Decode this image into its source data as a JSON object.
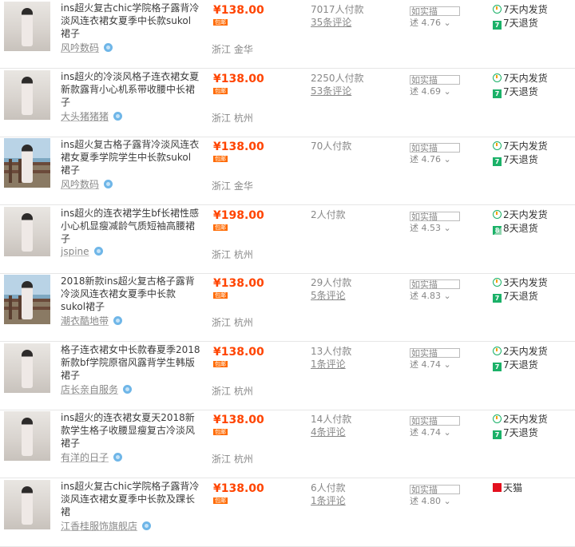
{
  "products": [
    {
      "title": "ins超火复古chic学院格子露背冷淡风连衣裙女夏季中长款sukol裙子",
      "price": "¥138.00",
      "shipping_tag": "包邮",
      "shop": "风吟数码",
      "location": "浙江 金华",
      "sales": "7017人付款",
      "reviews": "35条评论",
      "desc_label": "如实描",
      "score": "述 4.76 ⌄",
      "services": [
        {
          "icon": "clock-icon",
          "label": "7天内发货"
        },
        {
          "icon": "seven-day-return-icon",
          "label": "7天退货"
        }
      ],
      "image": "girl-indoor"
    },
    {
      "title": "ins超火的冷淡风格子连衣裙女夏新款露背小心机系带收腰中长裙子",
      "price": "¥138.00",
      "shipping_tag": "包邮",
      "shop": "大头猪猪猪",
      "location": "浙江 杭州",
      "sales": "2250人付款",
      "reviews": "53条评论",
      "desc_label": "如实描",
      "score": "述 4.69 ⌄",
      "services": [
        {
          "icon": "clock-icon",
          "label": "7天内发货"
        },
        {
          "icon": "seven-day-return-icon",
          "label": "7天退货"
        }
      ],
      "image": "girl-indoor"
    },
    {
      "title": "ins超火复古格子露背冷淡风连衣裙女夏季学院学生中长款sukol裙子",
      "price": "¥138.00",
      "shipping_tag": "包邮",
      "shop": "风吟数码",
      "location": "浙江 金华",
      "sales": "70人付款",
      "reviews": "",
      "desc_label": "如实描",
      "score": "述 4.76 ⌄",
      "services": [
        {
          "icon": "clock-icon",
          "label": "7天内发货"
        },
        {
          "icon": "seven-day-return-icon",
          "label": "7天退货"
        }
      ],
      "image": "girl-seaside"
    },
    {
      "title": "ins超火的连衣裙学生bf长裙性感小心机显瘦减龄气质短袖高腰裙子",
      "price": "¥198.00",
      "shipping_tag": "包邮",
      "shop": "jspine",
      "location": "浙江 杭州",
      "sales": "2人付款",
      "reviews": "",
      "desc_label": "如实描",
      "score": "述 4.53 ⌄",
      "services": [
        {
          "icon": "clock-icon",
          "label": "2天内发货"
        },
        {
          "icon": "eight-day-return-icon",
          "label": "8天退货"
        }
      ],
      "image": "girl-indoor"
    },
    {
      "title": "2018新款ins超火复古格子露背冷淡风连衣裙女夏季中长款sukol裙子",
      "price": "¥138.00",
      "shipping_tag": "包邮",
      "shop": "潮衣酷地带",
      "location": "浙江 杭州",
      "sales": "29人付款",
      "reviews": "5条评论",
      "desc_label": "如实描",
      "score": "述 4.83 ⌄",
      "services": [
        {
          "icon": "clock-icon",
          "label": "3天内发货"
        },
        {
          "icon": "seven-day-return-icon",
          "label": "7天退货"
        }
      ],
      "image": "girl-seaside"
    },
    {
      "title": "格子连衣裙女中长款春夏季2018新款bf学院原宿风露背学生韩版裙子",
      "price": "¥138.00",
      "shipping_tag": "包邮",
      "shop": "店长亲自服务",
      "location": "浙江 杭州",
      "sales": "13人付款",
      "reviews": "1条评论",
      "desc_label": "如实描",
      "score": "述 4.74 ⌄",
      "services": [
        {
          "icon": "clock-icon",
          "label": "2天内发货"
        },
        {
          "icon": "seven-day-return-icon",
          "label": "7天退货"
        }
      ],
      "image": "girl-indoor"
    },
    {
      "title": "ins超火的连衣裙女夏天2018新款学生格子收腰显瘦复古冷淡风裙子",
      "price": "¥138.00",
      "shipping_tag": "包邮",
      "shop": "有洋的日子",
      "location": "浙江 杭州",
      "sales": "14人付款",
      "reviews": "4条评论",
      "desc_label": "如实描",
      "score": "述 4.74 ⌄",
      "services": [
        {
          "icon": "clock-icon",
          "label": "2天内发货"
        },
        {
          "icon": "seven-day-return-icon",
          "label": "7天退货"
        }
      ],
      "image": "girl-indoor"
    },
    {
      "title": "ins超火复古chic学院格子露背冷淡风连衣裙女夏季中长款及踝长裙",
      "price": "¥138.00",
      "shipping_tag": "包邮",
      "shop": "江香桂服饰旗舰店",
      "location": "",
      "sales": "6人付款",
      "reviews": "1条评论",
      "desc_label": "如实描",
      "score": "述 4.80 ⌄",
      "services": [
        {
          "icon": "tmall-icon",
          "label": "天猫"
        }
      ],
      "image": "girl-indoor"
    }
  ]
}
